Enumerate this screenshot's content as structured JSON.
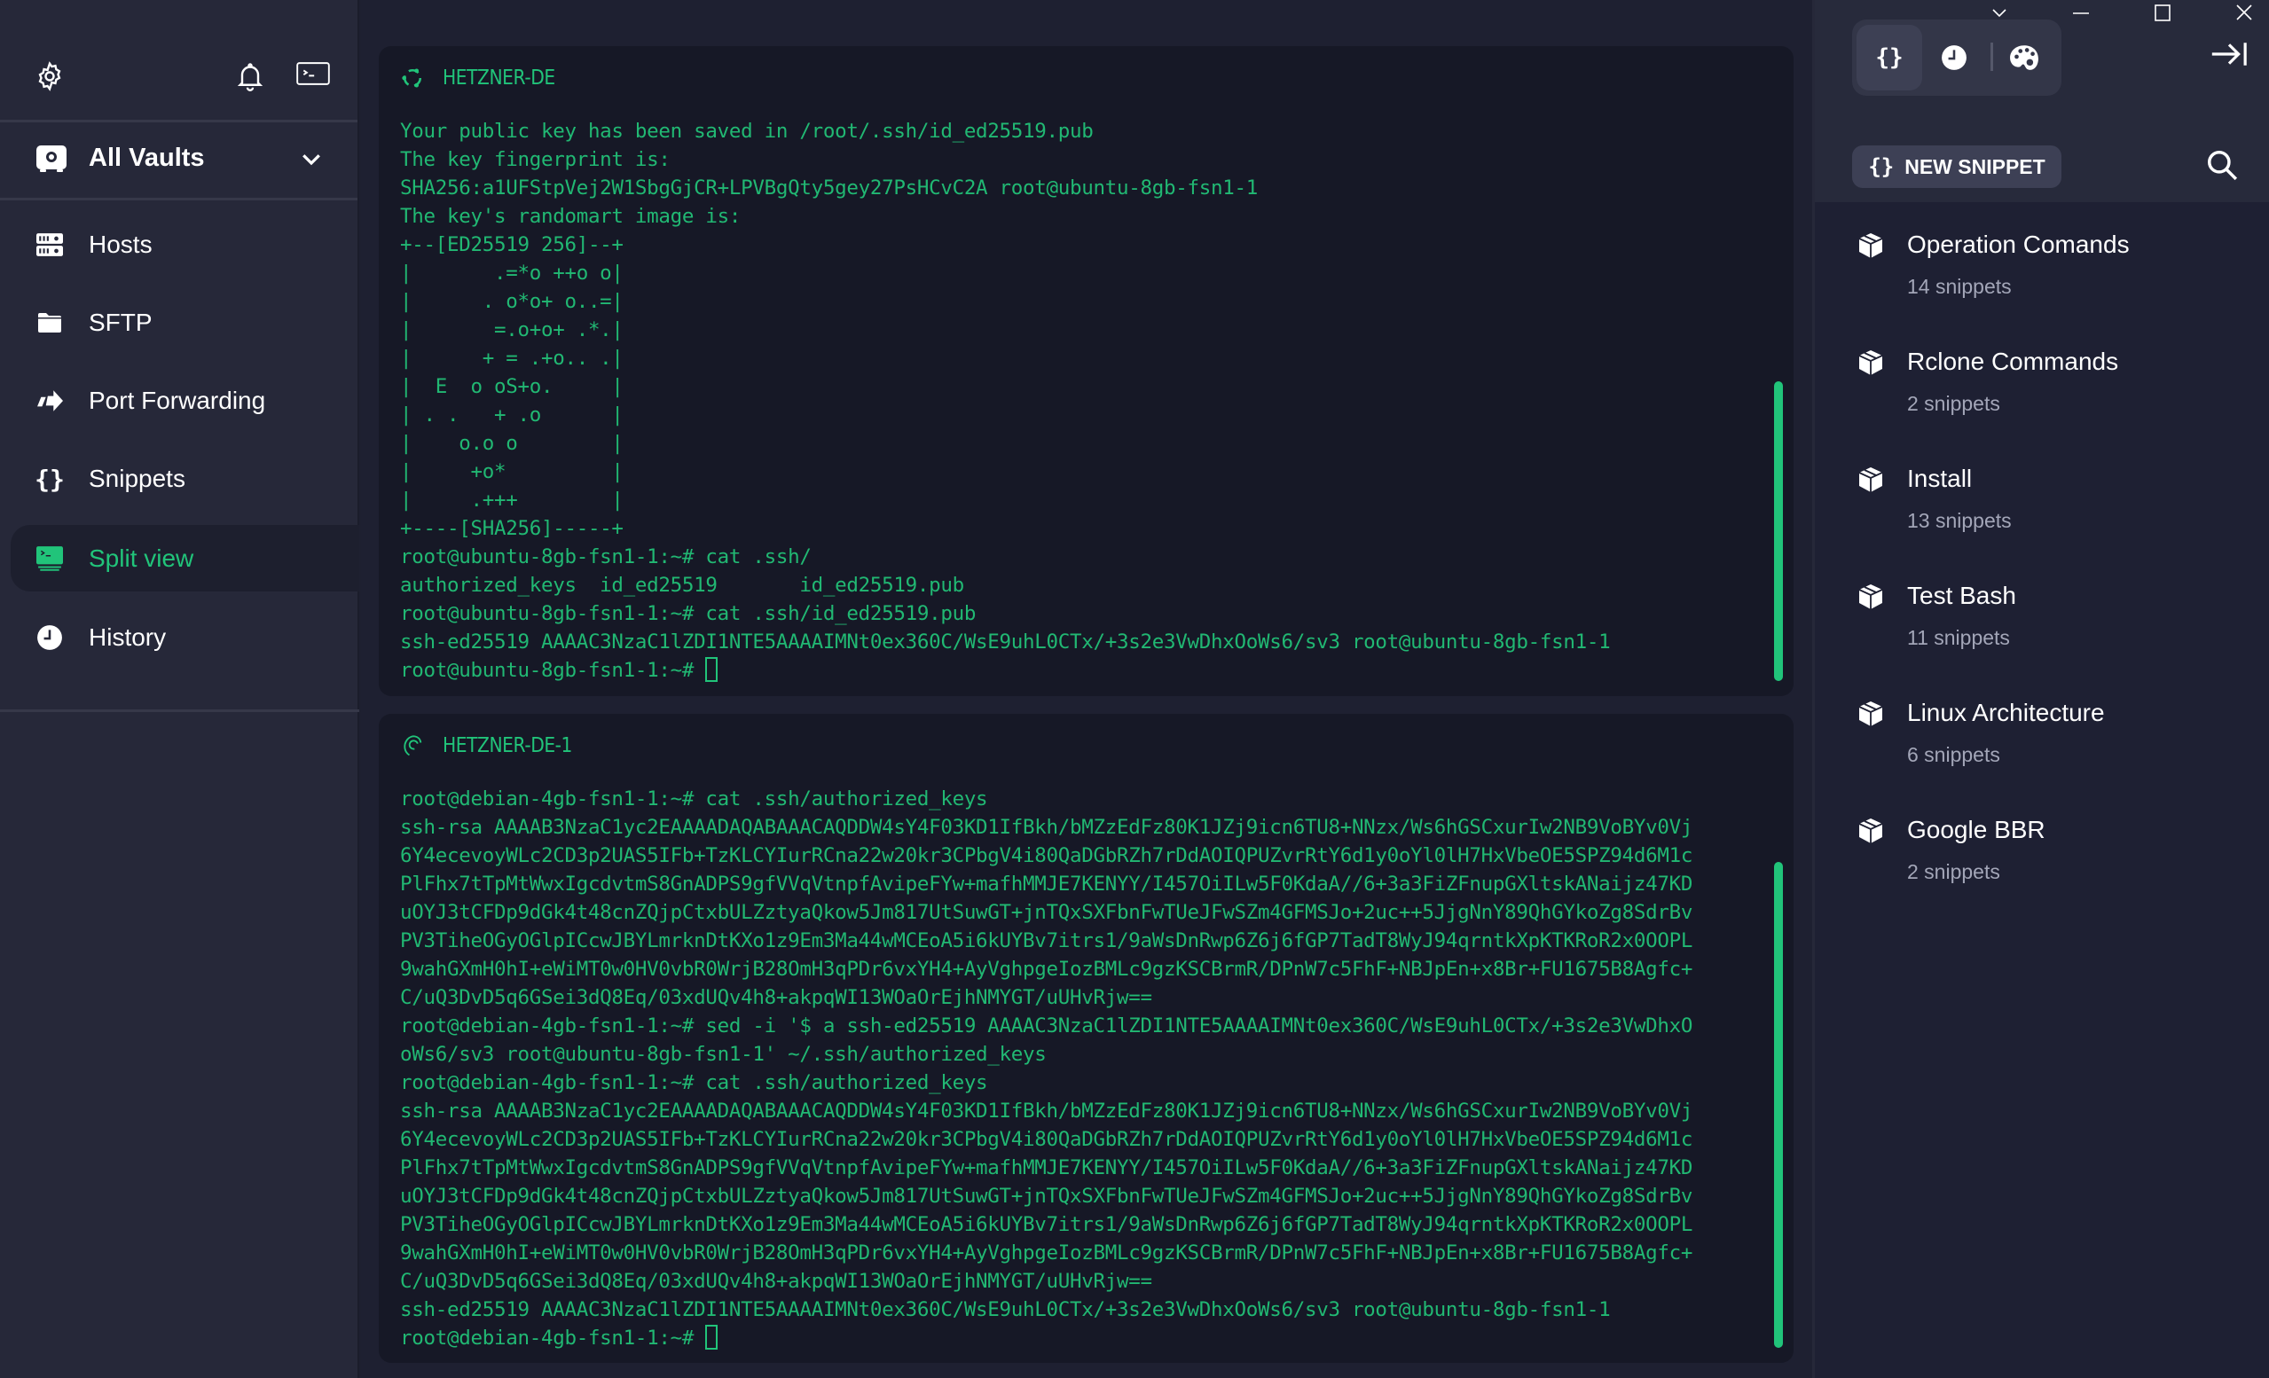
{
  "sidebar": {
    "vault_label": "All Vaults",
    "nav": [
      {
        "label": "Hosts",
        "icon": "hosts-icon"
      },
      {
        "label": "SFTP",
        "icon": "folder-icon"
      },
      {
        "label": "Port Forwarding",
        "icon": "port-forward-icon"
      },
      {
        "label": "Snippets",
        "icon": "braces-icon"
      },
      {
        "label": "Split view",
        "icon": "split-view-icon",
        "active": true
      },
      {
        "label": "History",
        "icon": "clock-icon"
      }
    ]
  },
  "colors": {
    "accent": "#21c47a",
    "terminal_text": "#21b873",
    "terminal_bg": "#161826",
    "sidebar_bg": "#262839"
  },
  "panes": [
    {
      "title": "HETZNER-DE",
      "os_icon": "ubuntu-icon",
      "lines": [
        "Your public key has been saved in /root/.ssh/id_ed25519.pub",
        "The key fingerprint is:",
        "SHA256:a1UFStpVej2W1SbgGjCR+LPVBgQty5gey27PsHCvC2A root@ubuntu-8gb-fsn1-1",
        "The key's randomart image is:",
        "+--[ED25519 256]--+",
        "|       .=*o ++o o|",
        "|      . o*o+ o..=|",
        "|       =.o+o+ .*.|",
        "|      + = .+o.. .|",
        "|  E  o oS+o.     |",
        "| . .   + .o      |",
        "|    o.o o        |",
        "|     +o*         |",
        "|     .+++        |",
        "+----[SHA256]-----+",
        "root@ubuntu-8gb-fsn1-1:~# cat .ssh/",
        "authorized_keys  id_ed25519       id_ed25519.pub",
        "root@ubuntu-8gb-fsn1-1:~# cat .ssh/id_ed25519.pub",
        "ssh-ed25519 AAAAC3NzaC1lZDI1NTE5AAAAIMNt0ex360C/WsE9uhL0CTx/+3s2e3VwDhxOoWs6/sv3 root@ubuntu-8gb-fsn1-1"
      ],
      "prompt": "root@ubuntu-8gb-fsn1-1:~# "
    },
    {
      "title": "HETZNER-DE-1",
      "os_icon": "debian-icon",
      "lines": [
        "root@debian-4gb-fsn1-1:~# cat .ssh/authorized_keys",
        "ssh-rsa AAAAB3NzaC1yc2EAAAADAQABAAACAQDDW4sY4F03KD1IfBkh/bMZzEdFz80K1JZj9icn6TU8+NNzx/Ws6hGSCxurIw2NB9VoBYv0Vj",
        "6Y4ecevoyWLc2CD3p2UAS5IFb+TzKLCYIurRCna22w20kr3CPbgV4i80QaDGbRZh7rDdAOIQPUZvrRtY6d1y0oYl0lH7HxVbeOE5SPZ94d6M1c",
        "PlFhx7tTpMtWwxIgcdvtmS8GnADPS9gfVVqVtnpfAvipeFYw+mafhMMJE7KENYY/I457OiILw5F0KdaA//6+3a3FiZFnupGXltskANaijz47KD",
        "uOYJ3tCFDp9dGk4t48cnZQjpCtxbULZztyaQkow5Jm817UtSuwGT+jnTQxSXFbnFwTUeJFwSZm4GFMSJo+2uc++5JjgNnY89QhGYkoZg8SdrBv",
        "PV3TiheOGyOGlpICcwJBYLmrknDtKXo1z9Em3Ma44wMCEoA5i6kUYBv7itrs1/9aWsDnRwp6Z6j6fGP7TadT8WyJ94qrntkXpKTKRoR2x0OOPL",
        "9wahGXmH0hI+eWiMT0w0HV0vbR0WrjB28OmH3qPDr6vxYH4+AyVghpgeIozBMLc9gzKSCBrmR/DPnW7c5FhF+NBJpEn+x8Br+FU1675B8Agfc+",
        "C/uQ3DvD5q6GSei3dQ8Eq/03xdUQv4h8+akpqWI13WOaOrEjhNMYGT/uUHvRjw==",
        "root@debian-4gb-fsn1-1:~# sed -i '$ a ssh-ed25519 AAAAC3NzaC1lZDI1NTE5AAAAIMNt0ex360C/WsE9uhL0CTx/+3s2e3VwDhxO",
        "oWs6/sv3 root@ubuntu-8gb-fsn1-1' ~/.ssh/authorized_keys",
        "root@debian-4gb-fsn1-1:~# cat .ssh/authorized_keys",
        "ssh-rsa AAAAB3NzaC1yc2EAAAADAQABAAACAQDDW4sY4F03KD1IfBkh/bMZzEdFz80K1JZj9icn6TU8+NNzx/Ws6hGSCxurIw2NB9VoBYv0Vj",
        "6Y4ecevoyWLc2CD3p2UAS5IFb+TzKLCYIurRCna22w20kr3CPbgV4i80QaDGbRZh7rDdAOIQPUZvrRtY6d1y0oYl0lH7HxVbeOE5SPZ94d6M1c",
        "PlFhx7tTpMtWwxIgcdvtmS8GnADPS9gfVVqVtnpfAvipeFYw+mafhMMJE7KENYY/I457OiILw5F0KdaA//6+3a3FiZFnupGXltskANaijz47KD",
        "uOYJ3tCFDp9dGk4t48cnZQjpCtxbULZztyaQkow5Jm817UtSuwGT+jnTQxSXFbnFwTUeJFwSZm4GFMSJo+2uc++5JjgNnY89QhGYkoZg8SdrBv",
        "PV3TiheOGyOGlpICcwJBYLmrknDtKXo1z9Em3Ma44wMCEoA5i6kUYBv7itrs1/9aWsDnRwp6Z6j6fGP7TadT8WyJ94qrntkXpKTKRoR2x0OOPL",
        "9wahGXmH0hI+eWiMT0w0HV0vbR0WrjB28OmH3qPDr6vxYH4+AyVghpgeIozBMLc9gzKSCBrmR/DPnW7c5FhF+NBJpEn+x8Br+FU1675B8Agfc+",
        "C/uQ3DvD5q6GSei3dQ8Eq/03xdUQv4h8+akpqWI13WOaOrEjhNMYGT/uUHvRjw==",
        "ssh-ed25519 AAAAC3NzaC1lZDI1NTE5AAAAIMNt0ex360C/WsE9uhL0CTx/+3s2e3VwDhxOoWs6/sv3 root@ubuntu-8gb-fsn1-1"
      ],
      "prompt": "root@debian-4gb-fsn1-1:~# "
    }
  ],
  "snippets_panel": {
    "tabs": [
      {
        "icon": "braces-icon",
        "active": true
      },
      {
        "icon": "clock-icon"
      },
      {
        "icon": "palette-icon"
      }
    ],
    "new_snippet_label": "NEW SNIPPET",
    "groups": [
      {
        "name": "Operation Comands",
        "count": "14 snippets"
      },
      {
        "name": "Rclone Commands",
        "count": "2 snippets"
      },
      {
        "name": "Install",
        "count": "13 snippets"
      },
      {
        "name": "Test Bash",
        "count": "11 snippets"
      },
      {
        "name": "Linux Architecture",
        "count": "6 snippets"
      },
      {
        "name": "Google BBR",
        "count": "2 snippets"
      }
    ]
  }
}
